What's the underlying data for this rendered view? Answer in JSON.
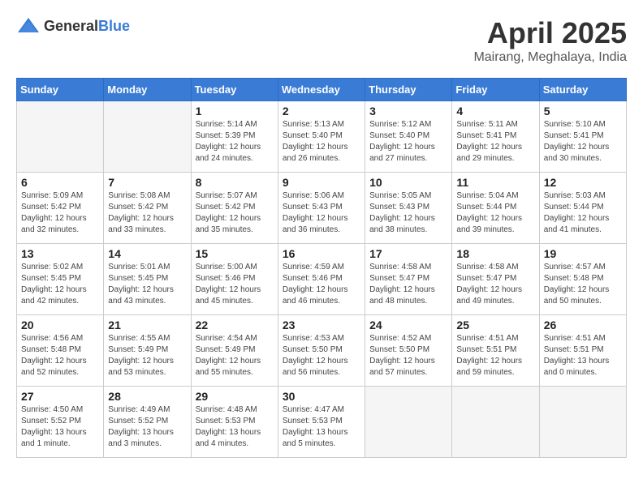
{
  "header": {
    "logo_general": "General",
    "logo_blue": "Blue",
    "month": "April 2025",
    "location": "Mairang, Meghalaya, India"
  },
  "weekdays": [
    "Sunday",
    "Monday",
    "Tuesday",
    "Wednesday",
    "Thursday",
    "Friday",
    "Saturday"
  ],
  "weeks": [
    [
      {
        "day": "",
        "info": ""
      },
      {
        "day": "",
        "info": ""
      },
      {
        "day": "1",
        "info": "Sunrise: 5:14 AM\nSunset: 5:39 PM\nDaylight: 12 hours\nand 24 minutes."
      },
      {
        "day": "2",
        "info": "Sunrise: 5:13 AM\nSunset: 5:40 PM\nDaylight: 12 hours\nand 26 minutes."
      },
      {
        "day": "3",
        "info": "Sunrise: 5:12 AM\nSunset: 5:40 PM\nDaylight: 12 hours\nand 27 minutes."
      },
      {
        "day": "4",
        "info": "Sunrise: 5:11 AM\nSunset: 5:41 PM\nDaylight: 12 hours\nand 29 minutes."
      },
      {
        "day": "5",
        "info": "Sunrise: 5:10 AM\nSunset: 5:41 PM\nDaylight: 12 hours\nand 30 minutes."
      }
    ],
    [
      {
        "day": "6",
        "info": "Sunrise: 5:09 AM\nSunset: 5:42 PM\nDaylight: 12 hours\nand 32 minutes."
      },
      {
        "day": "7",
        "info": "Sunrise: 5:08 AM\nSunset: 5:42 PM\nDaylight: 12 hours\nand 33 minutes."
      },
      {
        "day": "8",
        "info": "Sunrise: 5:07 AM\nSunset: 5:42 PM\nDaylight: 12 hours\nand 35 minutes."
      },
      {
        "day": "9",
        "info": "Sunrise: 5:06 AM\nSunset: 5:43 PM\nDaylight: 12 hours\nand 36 minutes."
      },
      {
        "day": "10",
        "info": "Sunrise: 5:05 AM\nSunset: 5:43 PM\nDaylight: 12 hours\nand 38 minutes."
      },
      {
        "day": "11",
        "info": "Sunrise: 5:04 AM\nSunset: 5:44 PM\nDaylight: 12 hours\nand 39 minutes."
      },
      {
        "day": "12",
        "info": "Sunrise: 5:03 AM\nSunset: 5:44 PM\nDaylight: 12 hours\nand 41 minutes."
      }
    ],
    [
      {
        "day": "13",
        "info": "Sunrise: 5:02 AM\nSunset: 5:45 PM\nDaylight: 12 hours\nand 42 minutes."
      },
      {
        "day": "14",
        "info": "Sunrise: 5:01 AM\nSunset: 5:45 PM\nDaylight: 12 hours\nand 43 minutes."
      },
      {
        "day": "15",
        "info": "Sunrise: 5:00 AM\nSunset: 5:46 PM\nDaylight: 12 hours\nand 45 minutes."
      },
      {
        "day": "16",
        "info": "Sunrise: 4:59 AM\nSunset: 5:46 PM\nDaylight: 12 hours\nand 46 minutes."
      },
      {
        "day": "17",
        "info": "Sunrise: 4:58 AM\nSunset: 5:47 PM\nDaylight: 12 hours\nand 48 minutes."
      },
      {
        "day": "18",
        "info": "Sunrise: 4:58 AM\nSunset: 5:47 PM\nDaylight: 12 hours\nand 49 minutes."
      },
      {
        "day": "19",
        "info": "Sunrise: 4:57 AM\nSunset: 5:48 PM\nDaylight: 12 hours\nand 50 minutes."
      }
    ],
    [
      {
        "day": "20",
        "info": "Sunrise: 4:56 AM\nSunset: 5:48 PM\nDaylight: 12 hours\nand 52 minutes."
      },
      {
        "day": "21",
        "info": "Sunrise: 4:55 AM\nSunset: 5:49 PM\nDaylight: 12 hours\nand 53 minutes."
      },
      {
        "day": "22",
        "info": "Sunrise: 4:54 AM\nSunset: 5:49 PM\nDaylight: 12 hours\nand 55 minutes."
      },
      {
        "day": "23",
        "info": "Sunrise: 4:53 AM\nSunset: 5:50 PM\nDaylight: 12 hours\nand 56 minutes."
      },
      {
        "day": "24",
        "info": "Sunrise: 4:52 AM\nSunset: 5:50 PM\nDaylight: 12 hours\nand 57 minutes."
      },
      {
        "day": "25",
        "info": "Sunrise: 4:51 AM\nSunset: 5:51 PM\nDaylight: 12 hours\nand 59 minutes."
      },
      {
        "day": "26",
        "info": "Sunrise: 4:51 AM\nSunset: 5:51 PM\nDaylight: 13 hours\nand 0 minutes."
      }
    ],
    [
      {
        "day": "27",
        "info": "Sunrise: 4:50 AM\nSunset: 5:52 PM\nDaylight: 13 hours\nand 1 minute."
      },
      {
        "day": "28",
        "info": "Sunrise: 4:49 AM\nSunset: 5:52 PM\nDaylight: 13 hours\nand 3 minutes."
      },
      {
        "day": "29",
        "info": "Sunrise: 4:48 AM\nSunset: 5:53 PM\nDaylight: 13 hours\nand 4 minutes."
      },
      {
        "day": "30",
        "info": "Sunrise: 4:47 AM\nSunset: 5:53 PM\nDaylight: 13 hours\nand 5 minutes."
      },
      {
        "day": "",
        "info": ""
      },
      {
        "day": "",
        "info": ""
      },
      {
        "day": "",
        "info": ""
      }
    ]
  ]
}
